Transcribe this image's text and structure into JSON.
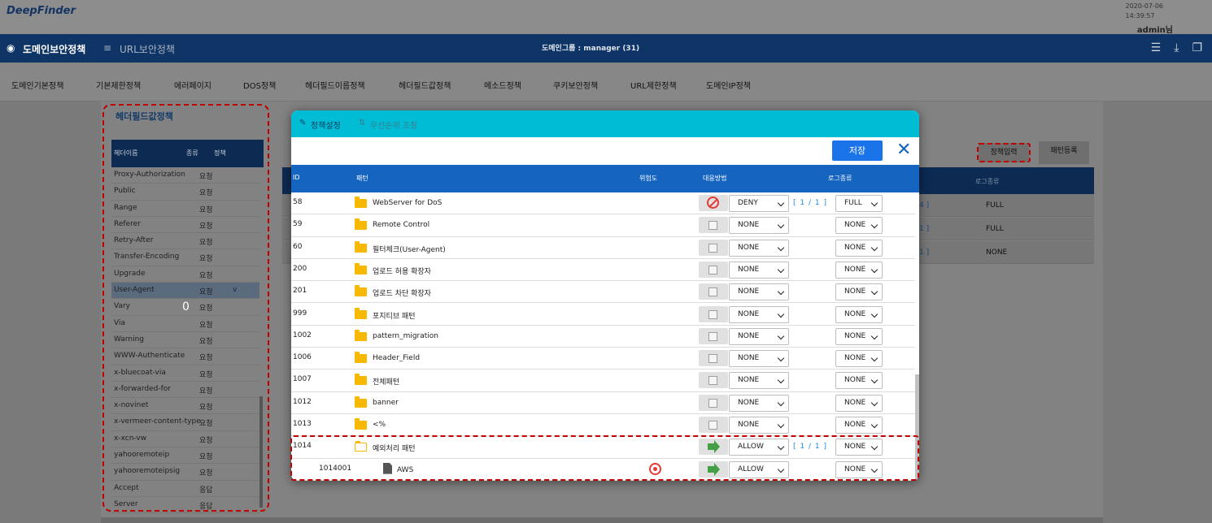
{
  "app": {
    "logo": "DeepFinder",
    "date": "2020-07-06",
    "time": "14:39:57",
    "user": "admin님"
  },
  "nav": {
    "tab1": "도메인보안정책",
    "tab2": "URL보안정책",
    "group": "도메인그룹 : manager (31)",
    "icons": [
      "list-icon",
      "download-icon",
      "copy-icon"
    ]
  },
  "menu": [
    "도메인기본정책",
    "기본제한정책",
    "에러페이지",
    "DOS정책",
    "헤더필드이름정책",
    "헤더필드값정책",
    "메소드정책",
    "쿠키보안정책",
    "URL제한정책",
    "도메인IP정책"
  ],
  "left": {
    "title": "헤더필드값정책",
    "cols": [
      "헤더이름",
      "종류",
      "정책"
    ],
    "rows": [
      {
        "name": "Proxy-Authorization",
        "type": "요청",
        "policy": ""
      },
      {
        "name": "Public",
        "type": "요청",
        "policy": ""
      },
      {
        "name": "Range",
        "type": "요청",
        "policy": ""
      },
      {
        "name": "Referer",
        "type": "요청",
        "policy": ""
      },
      {
        "name": "Retry-After",
        "type": "요청",
        "policy": ""
      },
      {
        "name": "Transfer-Encoding",
        "type": "요청",
        "policy": ""
      },
      {
        "name": "Upgrade",
        "type": "요청",
        "policy": ""
      },
      {
        "name": "User-Agent",
        "type": "요청",
        "policy": "v"
      },
      {
        "name": "Vary",
        "type": "요청",
        "policy": ""
      },
      {
        "name": "Via",
        "type": "요청",
        "policy": ""
      },
      {
        "name": "Warning",
        "type": "요청",
        "policy": ""
      },
      {
        "name": "WWW-Authenticate",
        "type": "요청",
        "policy": ""
      },
      {
        "name": "x-bluecoat-via",
        "type": "요청",
        "policy": ""
      },
      {
        "name": "x-forwarded-for",
        "type": "요청",
        "policy": ""
      },
      {
        "name": "x-novinet",
        "type": "요청",
        "policy": ""
      },
      {
        "name": "x-vermeer-content-type",
        "type": "요청",
        "policy": ""
      },
      {
        "name": "x-xcn-vw",
        "type": "요청",
        "policy": ""
      },
      {
        "name": "yahooremoteip",
        "type": "요청",
        "policy": ""
      },
      {
        "name": "yahooremoteipsig",
        "type": "요청",
        "policy": ""
      },
      {
        "name": "Accept",
        "type": "응답",
        "policy": ""
      },
      {
        "name": "Server",
        "type": "응답",
        "policy": ""
      }
    ],
    "zero": "0"
  },
  "right": {
    "btn_input": "정책입력",
    "btn_register": "패턴등록",
    "col_log": "로그종류",
    "rows": [
      {
        "cnt": "4 ]",
        "log": "FULL"
      },
      {
        "cnt": "1 ]",
        "log": "FULL"
      },
      {
        "cnt": "1 ]",
        "log": "NONE"
      }
    ]
  },
  "modal": {
    "tab_policy": "정책설정",
    "tab_priority": "우선순위 조정",
    "save": "저장",
    "cols": {
      "id": "ID",
      "pattern": "패턴",
      "risk": "위험도",
      "action": "대응방법",
      "log": "로그종류"
    },
    "rows": [
      {
        "id": "58",
        "name": "WebServer for DoS",
        "icon": "deny",
        "action": "DENY",
        "count": "[ 1 / 1 ]",
        "log": "FULL"
      },
      {
        "id": "59",
        "name": "Remote Control",
        "icon": "check",
        "action": "NONE",
        "count": "",
        "log": "NONE"
      },
      {
        "id": "60",
        "name": "필터체크(User-Agent)",
        "icon": "check",
        "action": "NONE",
        "count": "",
        "log": "NONE"
      },
      {
        "id": "200",
        "name": "업로드 허용 확장자",
        "icon": "check",
        "action": "NONE",
        "count": "",
        "log": "NONE"
      },
      {
        "id": "201",
        "name": "업로드 차단 확장자",
        "icon": "check",
        "action": "NONE",
        "count": "",
        "log": "NONE"
      },
      {
        "id": "999",
        "name": "포지티브 패턴",
        "icon": "check",
        "action": "NONE",
        "count": "",
        "log": "NONE"
      },
      {
        "id": "1002",
        "name": "pattern_migration",
        "icon": "check",
        "action": "NONE",
        "count": "",
        "log": "NONE"
      },
      {
        "id": "1006",
        "name": "Header_Field",
        "icon": "check",
        "action": "NONE",
        "count": "",
        "log": "NONE"
      },
      {
        "id": "1007",
        "name": "전체패턴",
        "icon": "check",
        "action": "NONE",
        "count": "",
        "log": "NONE"
      },
      {
        "id": "1012",
        "name": "banner",
        "icon": "check",
        "action": "NONE",
        "count": "",
        "log": "NONE"
      },
      {
        "id": "1013",
        "name": "<%",
        "icon": "check",
        "action": "NONE",
        "count": "",
        "log": "NONE"
      },
      {
        "id": "1014",
        "name": "예외처리 패턴",
        "icon": "allow",
        "action": "ALLOW",
        "count": "[ 1 / 1 ]",
        "log": "NONE"
      }
    ],
    "child": {
      "id": "1014001",
      "name": "AWS",
      "action": "ALLOW",
      "log": "NONE"
    }
  }
}
